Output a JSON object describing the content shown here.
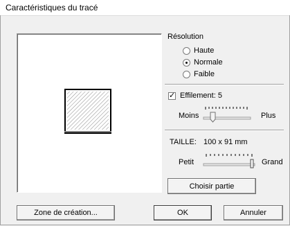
{
  "window": {
    "title": "Caractéristiques du tracé"
  },
  "resolution": {
    "label": "Résolution",
    "options": [
      {
        "label": "Haute",
        "checked": false
      },
      {
        "label": "Normale",
        "checked": true
      },
      {
        "label": "Faible",
        "checked": false
      }
    ]
  },
  "effilement": {
    "label": "Effilement: 5",
    "checked": true,
    "value": 5
  },
  "effilement_slider": {
    "min_label": "Moins",
    "max_label": "Plus"
  },
  "taille": {
    "label": "TAILLE:",
    "value": "100 x 91 mm"
  },
  "size_slider": {
    "min_label": "Petit",
    "max_label": "Grand"
  },
  "buttons": {
    "choose_part": "Choisir partie",
    "zone": "Zone de création...",
    "ok": "OK",
    "cancel": "Annuler"
  }
}
